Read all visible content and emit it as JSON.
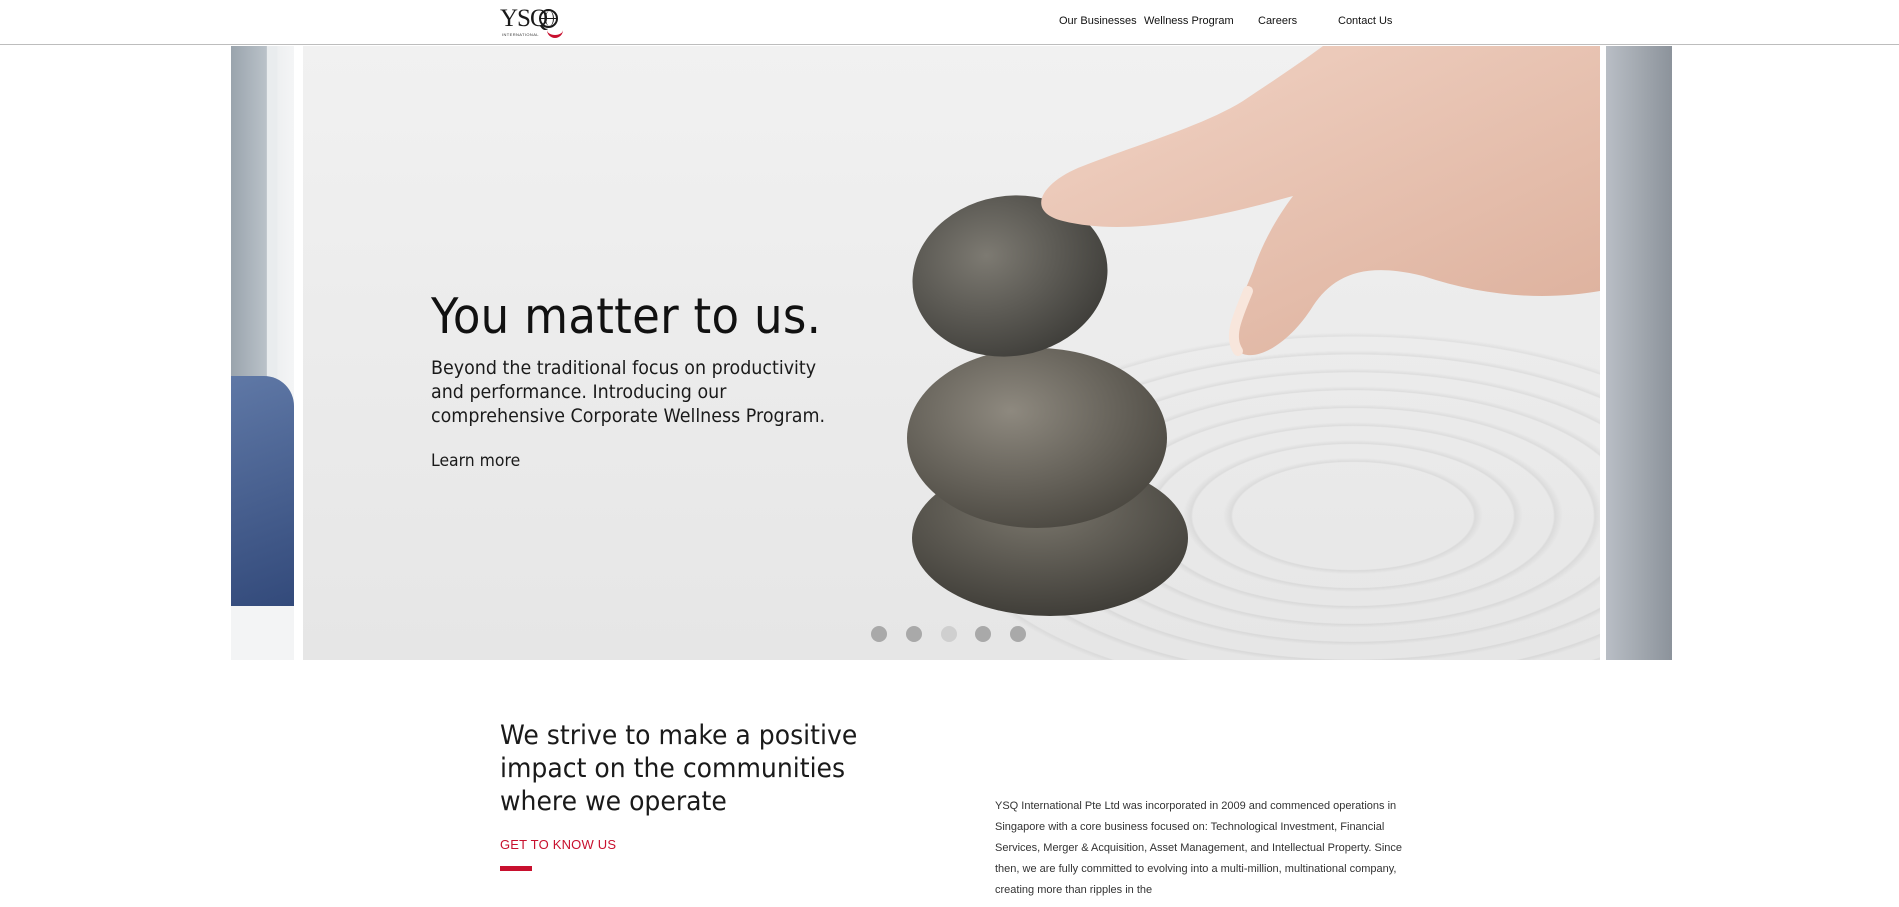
{
  "brand": {
    "logo_text": "YSQ",
    "logo_subtext": "INTERNATIONAL",
    "accent_color": "#c8102e"
  },
  "nav": {
    "items": [
      {
        "label": "Our Businesses"
      },
      {
        "label": "Wellness Program"
      },
      {
        "label": "Careers"
      },
      {
        "label": "Contact Us"
      }
    ]
  },
  "hero": {
    "title": "You matter to us.",
    "description": "Beyond the traditional focus on productivity and performance. Introducing our comprehensive Corporate Wellness Program.",
    "link_label": "Learn more",
    "slides_count": 5,
    "active_slide": 3
  },
  "about": {
    "heading": "We strive to make a positive impact on the communities where we operate",
    "link_label": "GET TO KNOW US",
    "body": "YSQ International Pte Ltd was incorporated in 2009 and commenced operations in Singapore with a core business focused on: Technological Investment, Financial Services, Merger & Acquisition, Asset Management, and Intellectual Property. Since then, we are fully committed to evolving into a multi-million, multinational company, creating more than ripples in the"
  }
}
